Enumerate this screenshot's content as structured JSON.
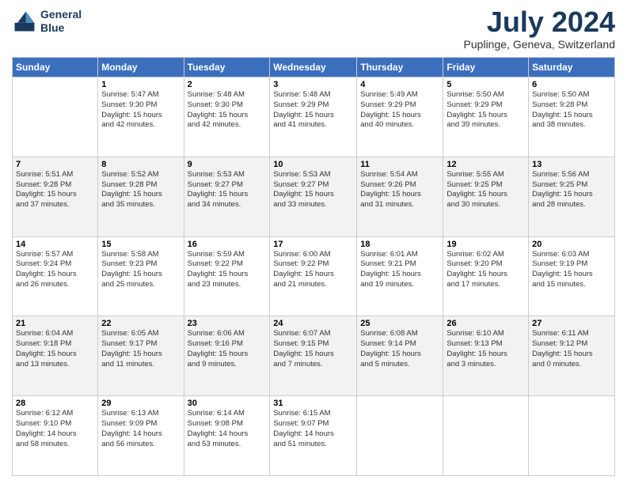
{
  "header": {
    "logo_line1": "General",
    "logo_line2": "Blue",
    "month": "July 2024",
    "location": "Puplinge, Geneva, Switzerland"
  },
  "days_of_week": [
    "Sunday",
    "Monday",
    "Tuesday",
    "Wednesday",
    "Thursday",
    "Friday",
    "Saturday"
  ],
  "weeks": [
    [
      {
        "day": "",
        "info": ""
      },
      {
        "day": "1",
        "info": "Sunrise: 5:47 AM\nSunset: 9:30 PM\nDaylight: 15 hours\nand 42 minutes."
      },
      {
        "day": "2",
        "info": "Sunrise: 5:48 AM\nSunset: 9:30 PM\nDaylight: 15 hours\nand 42 minutes."
      },
      {
        "day": "3",
        "info": "Sunrise: 5:48 AM\nSunset: 9:29 PM\nDaylight: 15 hours\nand 41 minutes."
      },
      {
        "day": "4",
        "info": "Sunrise: 5:49 AM\nSunset: 9:29 PM\nDaylight: 15 hours\nand 40 minutes."
      },
      {
        "day": "5",
        "info": "Sunrise: 5:50 AM\nSunset: 9:29 PM\nDaylight: 15 hours\nand 39 minutes."
      },
      {
        "day": "6",
        "info": "Sunrise: 5:50 AM\nSunset: 9:28 PM\nDaylight: 15 hours\nand 38 minutes."
      }
    ],
    [
      {
        "day": "7",
        "info": "Sunrise: 5:51 AM\nSunset: 9:28 PM\nDaylight: 15 hours\nand 37 minutes."
      },
      {
        "day": "8",
        "info": "Sunrise: 5:52 AM\nSunset: 9:28 PM\nDaylight: 15 hours\nand 35 minutes."
      },
      {
        "day": "9",
        "info": "Sunrise: 5:53 AM\nSunset: 9:27 PM\nDaylight: 15 hours\nand 34 minutes."
      },
      {
        "day": "10",
        "info": "Sunrise: 5:53 AM\nSunset: 9:27 PM\nDaylight: 15 hours\nand 33 minutes."
      },
      {
        "day": "11",
        "info": "Sunrise: 5:54 AM\nSunset: 9:26 PM\nDaylight: 15 hours\nand 31 minutes."
      },
      {
        "day": "12",
        "info": "Sunrise: 5:55 AM\nSunset: 9:25 PM\nDaylight: 15 hours\nand 30 minutes."
      },
      {
        "day": "13",
        "info": "Sunrise: 5:56 AM\nSunset: 9:25 PM\nDaylight: 15 hours\nand 28 minutes."
      }
    ],
    [
      {
        "day": "14",
        "info": "Sunrise: 5:57 AM\nSunset: 9:24 PM\nDaylight: 15 hours\nand 26 minutes."
      },
      {
        "day": "15",
        "info": "Sunrise: 5:58 AM\nSunset: 9:23 PM\nDaylight: 15 hours\nand 25 minutes."
      },
      {
        "day": "16",
        "info": "Sunrise: 5:59 AM\nSunset: 9:22 PM\nDaylight: 15 hours\nand 23 minutes."
      },
      {
        "day": "17",
        "info": "Sunrise: 6:00 AM\nSunset: 9:22 PM\nDaylight: 15 hours\nand 21 minutes."
      },
      {
        "day": "18",
        "info": "Sunrise: 6:01 AM\nSunset: 9:21 PM\nDaylight: 15 hours\nand 19 minutes."
      },
      {
        "day": "19",
        "info": "Sunrise: 6:02 AM\nSunset: 9:20 PM\nDaylight: 15 hours\nand 17 minutes."
      },
      {
        "day": "20",
        "info": "Sunrise: 6:03 AM\nSunset: 9:19 PM\nDaylight: 15 hours\nand 15 minutes."
      }
    ],
    [
      {
        "day": "21",
        "info": "Sunrise: 6:04 AM\nSunset: 9:18 PM\nDaylight: 15 hours\nand 13 minutes."
      },
      {
        "day": "22",
        "info": "Sunrise: 6:05 AM\nSunset: 9:17 PM\nDaylight: 15 hours\nand 11 minutes."
      },
      {
        "day": "23",
        "info": "Sunrise: 6:06 AM\nSunset: 9:16 PM\nDaylight: 15 hours\nand 9 minutes."
      },
      {
        "day": "24",
        "info": "Sunrise: 6:07 AM\nSunset: 9:15 PM\nDaylight: 15 hours\nand 7 minutes."
      },
      {
        "day": "25",
        "info": "Sunrise: 6:08 AM\nSunset: 9:14 PM\nDaylight: 15 hours\nand 5 minutes."
      },
      {
        "day": "26",
        "info": "Sunrise: 6:10 AM\nSunset: 9:13 PM\nDaylight: 15 hours\nand 3 minutes."
      },
      {
        "day": "27",
        "info": "Sunrise: 6:11 AM\nSunset: 9:12 PM\nDaylight: 15 hours\nand 0 minutes."
      }
    ],
    [
      {
        "day": "28",
        "info": "Sunrise: 6:12 AM\nSunset: 9:10 PM\nDaylight: 14 hours\nand 58 minutes."
      },
      {
        "day": "29",
        "info": "Sunrise: 6:13 AM\nSunset: 9:09 PM\nDaylight: 14 hours\nand 56 minutes."
      },
      {
        "day": "30",
        "info": "Sunrise: 6:14 AM\nSunset: 9:08 PM\nDaylight: 14 hours\nand 53 minutes."
      },
      {
        "day": "31",
        "info": "Sunrise: 6:15 AM\nSunset: 9:07 PM\nDaylight: 14 hours\nand 51 minutes."
      },
      {
        "day": "",
        "info": ""
      },
      {
        "day": "",
        "info": ""
      },
      {
        "day": "",
        "info": ""
      }
    ]
  ]
}
